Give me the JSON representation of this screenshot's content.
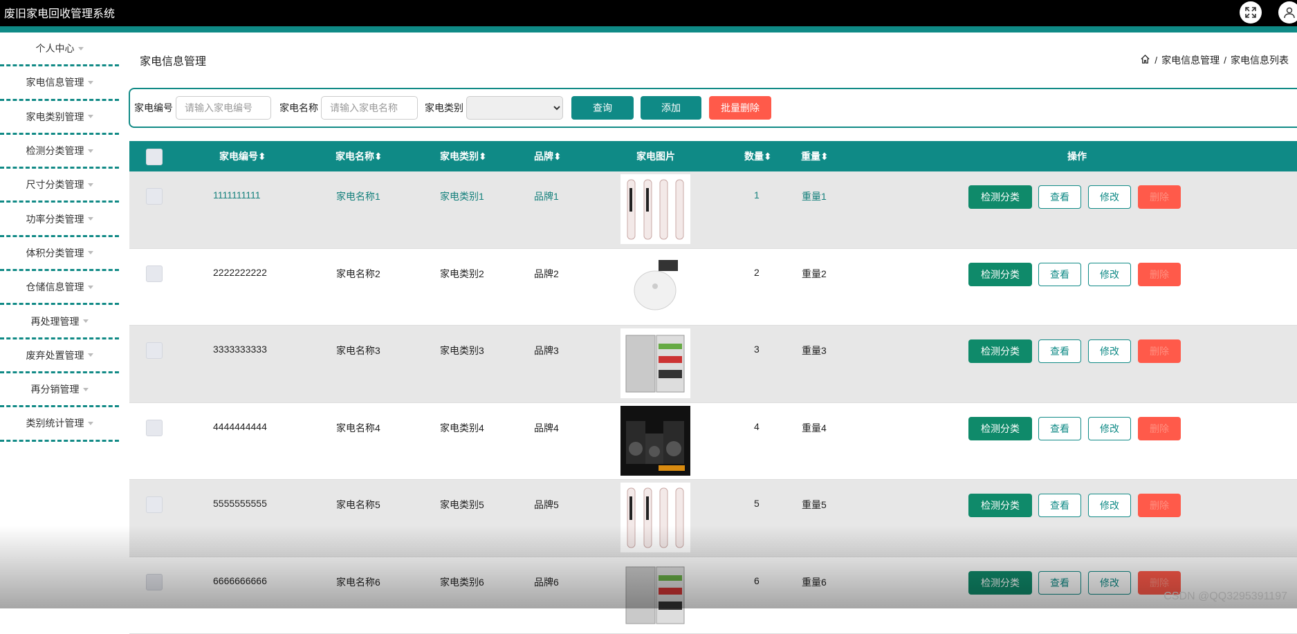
{
  "app": {
    "title": "废旧家电回收管理系统"
  },
  "sidebar": {
    "items": [
      {
        "label": "个人中心"
      },
      {
        "label": "家电信息管理"
      },
      {
        "label": "家电类别管理"
      },
      {
        "label": "检测分类管理"
      },
      {
        "label": "尺寸分类管理"
      },
      {
        "label": "功率分类管理"
      },
      {
        "label": "体积分类管理"
      },
      {
        "label": "仓储信息管理"
      },
      {
        "label": "再处理管理"
      },
      {
        "label": "废弃处置管理"
      },
      {
        "label": "再分销管理"
      },
      {
        "label": "类别统计管理"
      }
    ]
  },
  "page": {
    "title": "家电信息管理",
    "breadcrumb": [
      "家电信息管理",
      "家电信息列表"
    ]
  },
  "search": {
    "code_label": "家电编号",
    "code_placeholder": "请输入家电编号",
    "name_label": "家电名称",
    "name_placeholder": "请输入家电名称",
    "category_label": "家电类别",
    "category_value": "",
    "query_label": "查询",
    "add_label": "添加",
    "batch_delete_label": "批量删除"
  },
  "table": {
    "headers": [
      "家电编号",
      "家电名称",
      "家电类别",
      "品牌",
      "家电图片",
      "数量",
      "重量",
      "操作"
    ],
    "rows": [
      {
        "code": "1111111111",
        "name": "家电名称1",
        "category": "家电类别1",
        "brand": "品牌1",
        "qty": "1",
        "weight": "重量1",
        "image": "tower-fan-icon"
      },
      {
        "code": "2222222222",
        "name": "家电名称2",
        "category": "家电类别2",
        "brand": "品牌2",
        "qty": "2",
        "weight": "重量2",
        "image": "robot-vacuum-icon"
      },
      {
        "code": "3333333333",
        "name": "家电名称3",
        "category": "家电类别3",
        "brand": "品牌3",
        "qty": "3",
        "weight": "重量3",
        "image": "refrigerator-icon"
      },
      {
        "code": "4444444444",
        "name": "家电名称4",
        "category": "家电类别4",
        "brand": "品牌4",
        "qty": "4",
        "weight": "重量4",
        "image": "speakers-icon"
      },
      {
        "code": "5555555555",
        "name": "家电名称5",
        "category": "家电类别5",
        "brand": "品牌5",
        "qty": "5",
        "weight": "重量5",
        "image": "tower-fan-icon"
      },
      {
        "code": "6666666666",
        "name": "家电名称6",
        "category": "家电类别6",
        "brand": "品牌6",
        "qty": "6",
        "weight": "重量6",
        "image": "refrigerator-icon"
      }
    ],
    "actions": {
      "detect": "检测分类",
      "view": "查看",
      "edit": "修改",
      "delete": "删除"
    }
  },
  "watermark": "CSDN @QQ3295391197",
  "colors": {
    "teal": "#0f8a86",
    "danger": "#ff5a4a",
    "topbar": "#000000"
  }
}
